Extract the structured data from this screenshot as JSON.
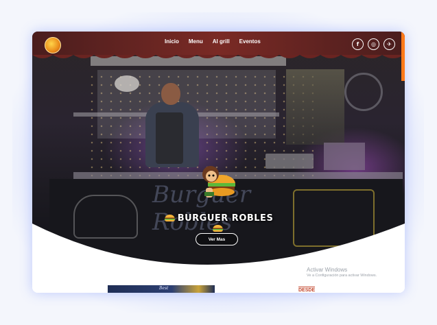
{
  "nav": {
    "items": [
      "Inicio",
      "Menu",
      "Al grill",
      "Eventos"
    ]
  },
  "social": {
    "facebook_glyph": "f",
    "instagram_glyph": "◎",
    "twitter_glyph": "✈",
    "icons": [
      "facebook-icon",
      "instagram-icon",
      "twitter-icon"
    ]
  },
  "hero": {
    "brand": "BURGUER ROBLES",
    "cta": "Ver Mas",
    "background_script": "Burguer Robles"
  },
  "windows_watermark": {
    "title": "Activar Windows",
    "subtitle": "Ve a Configuración para activar Windows."
  },
  "below": {
    "card_text": "Best",
    "desde": "DESDE"
  },
  "colors": {
    "accent": "#ff7a1a",
    "awning": "#7a2a25",
    "desde": "#c2442a"
  }
}
